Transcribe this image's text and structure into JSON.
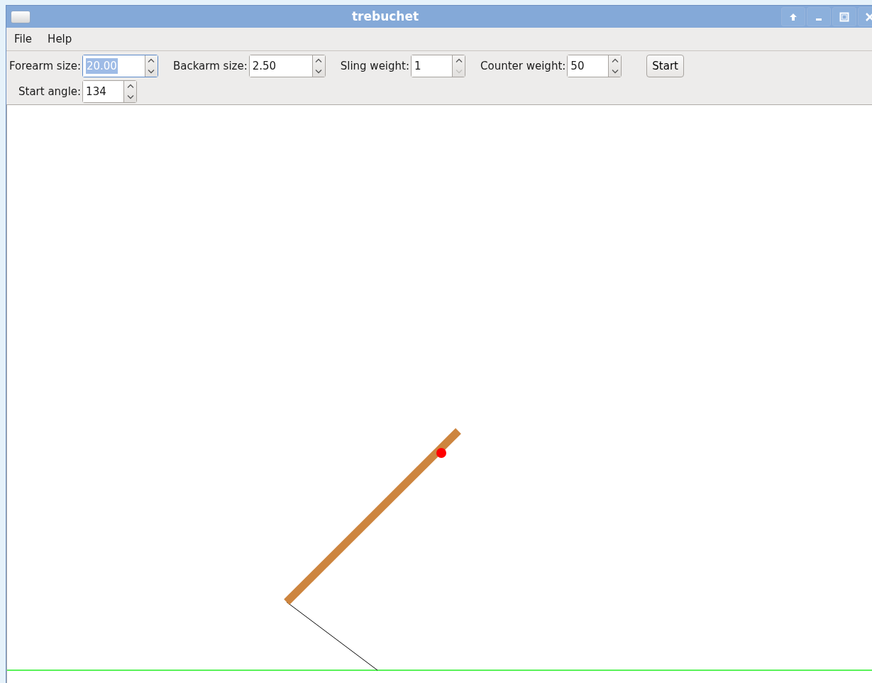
{
  "window": {
    "title": "trebuchet"
  },
  "menu": [
    {
      "label": "File"
    },
    {
      "label": "Help"
    }
  ],
  "spinners": [
    {
      "label": "Forearm size:",
      "value": "20.00",
      "text_selected": true,
      "up_disabled": false,
      "down_disabled": false
    },
    {
      "label": "Backarm size:",
      "value": "2.50",
      "text_selected": false,
      "up_disabled": false,
      "down_disabled": false
    },
    {
      "label": "Sling weight:",
      "value": "1",
      "text_selected": false,
      "up_disabled": false,
      "down_disabled": true
    },
    {
      "label": "Counter weight:",
      "value": "50",
      "text_selected": false,
      "up_disabled": false,
      "down_disabled": false
    }
  ],
  "start_button": {
    "label": "Start"
  },
  "second_row": [
    {
      "label": "Start angle:",
      "value": "134",
      "text_selected": false,
      "up_disabled": false,
      "down_disabled": false
    }
  ]
}
